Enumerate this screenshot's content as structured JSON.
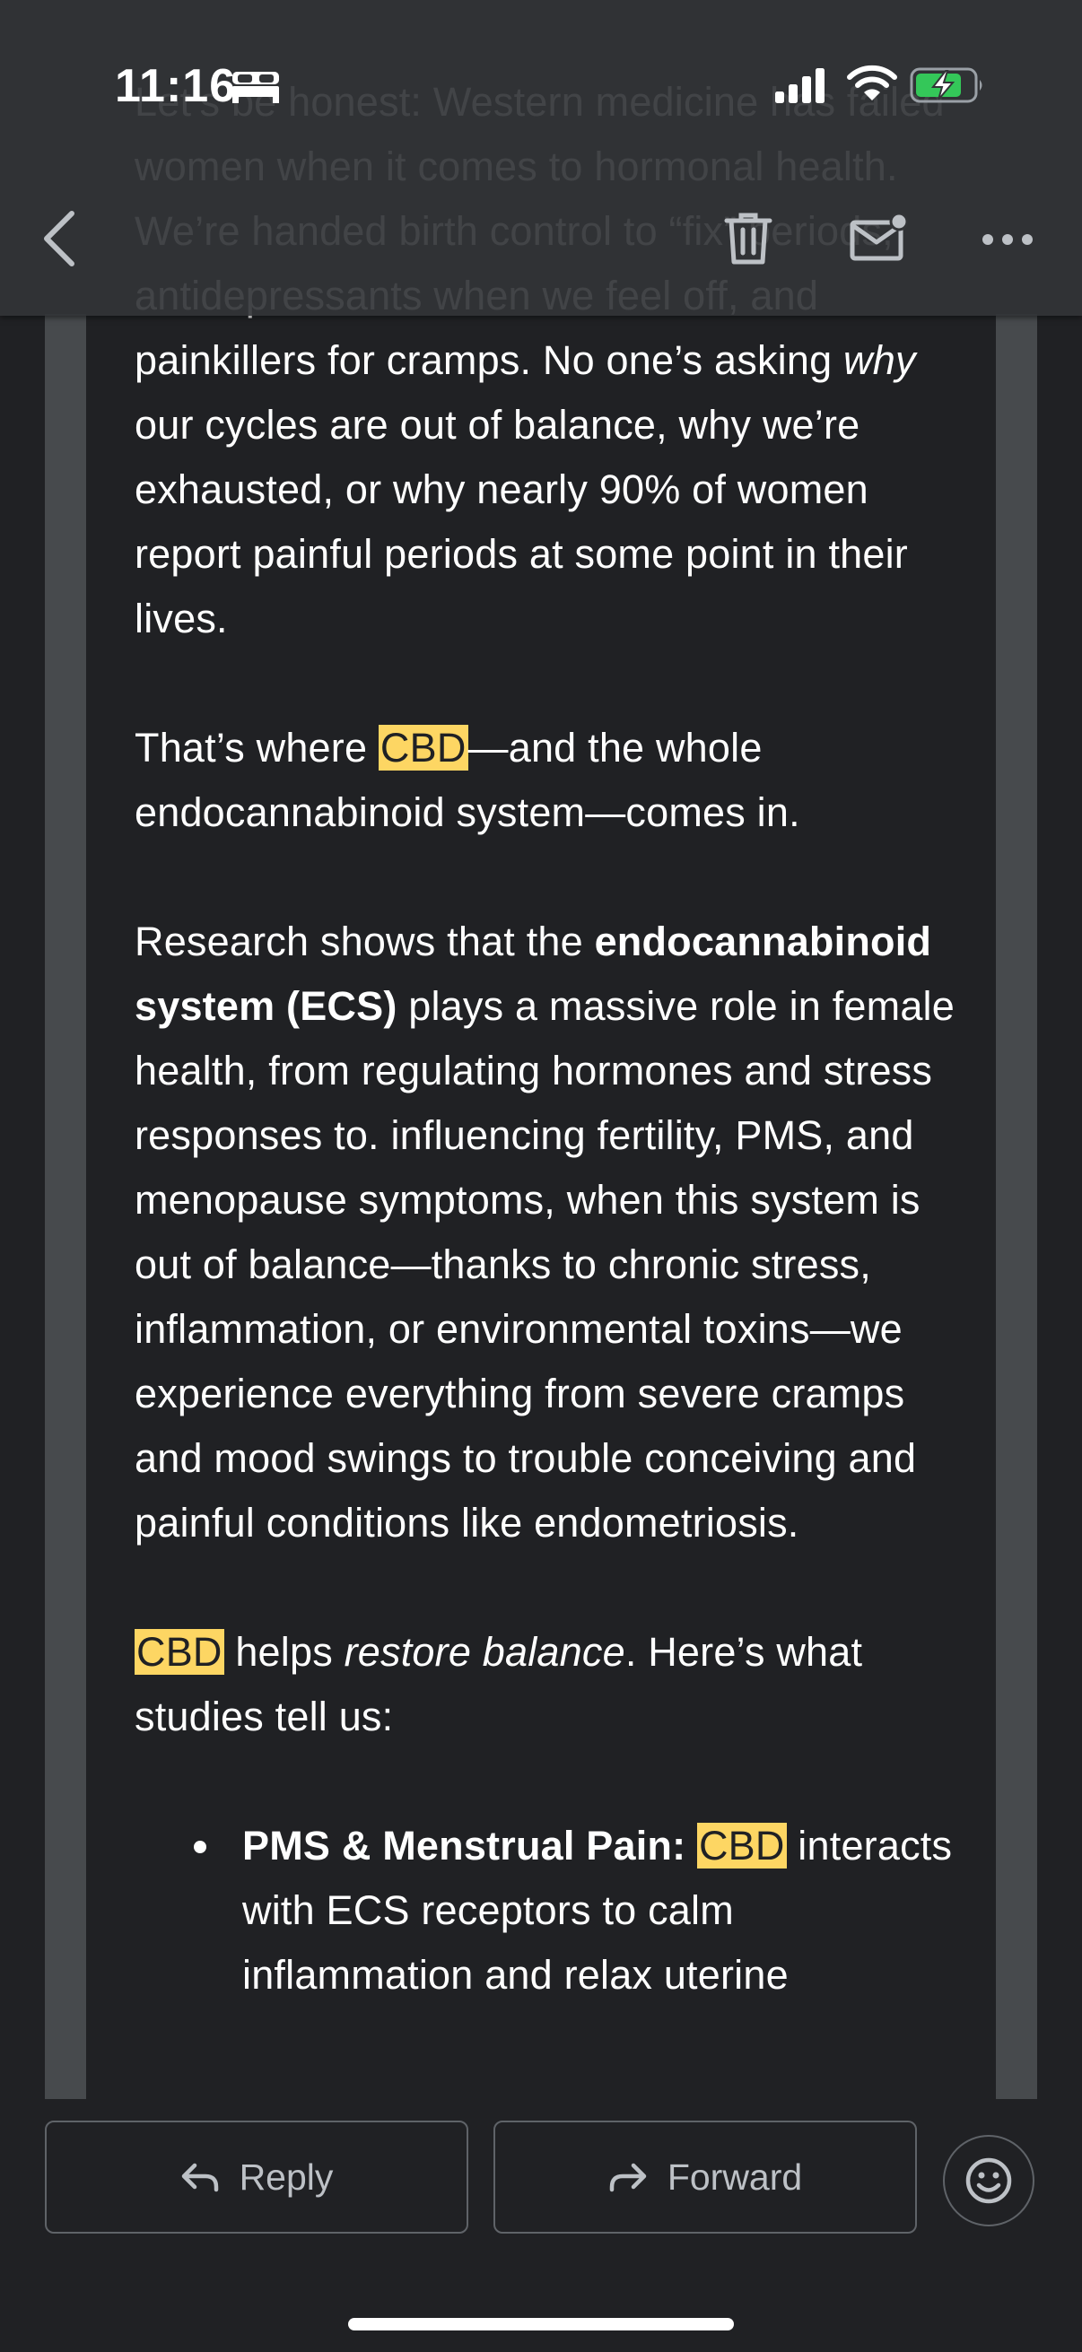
{
  "status_bar": {
    "time": "11:16",
    "icons": [
      "bed-icon",
      "cellular-signal-icon",
      "wifi-icon",
      "battery-charging-icon"
    ]
  },
  "toolbar": {
    "icons": [
      "back-chevron-icon",
      "trash-icon",
      "mark-unread-mail-icon",
      "more-options-icon"
    ]
  },
  "email": {
    "para1": {
      "t1": "Let’s be honest: Western medicine has failed women when it comes to hormonal health. We’re handed birth control to “fix” periods, antidepressants when we feel off, and painkillers for cramps. No one’s asking ",
      "t2": "why",
      "t3": " our cycles are out of balance, why we’re exhausted, or why nearly 90% of women report painful periods at some point in their lives."
    },
    "para2": {
      "t1": "That’s where ",
      "hl": "CBD",
      "t2": "—and the whole endocannabinoid system—comes in."
    },
    "para3": {
      "t1": "Research shows that the ",
      "bold": "endocannabinoid system (ECS)",
      "t2": " plays a massive role in female health, from regulating hormones and stress responses to. influencing fertility, PMS, and menopause symptoms, when this system is out of balance—thanks to chronic stress, inflammation, or environmental toxins—we experience everything from severe cramps and mood swings to trouble conceiving and painful conditions like endometriosis."
    },
    "para4": {
      "hl": "CBD",
      "t1": " helps ",
      "italic": "restore balance",
      "t2": ". Here’s what studies tell us:"
    },
    "bullet1": {
      "bold": "PMS & Menstrual Pain:",
      "hl": "CBD",
      "t1": " interacts with ECS receptors to calm inflammation and relax uterine"
    }
  },
  "actions": {
    "reply_label": "Reply",
    "forward_label": "Forward"
  },
  "colors": {
    "background": "#202124",
    "highlight": "#fdd663",
    "top_bar": "#323437",
    "battery_charging": "#34c759"
  }
}
